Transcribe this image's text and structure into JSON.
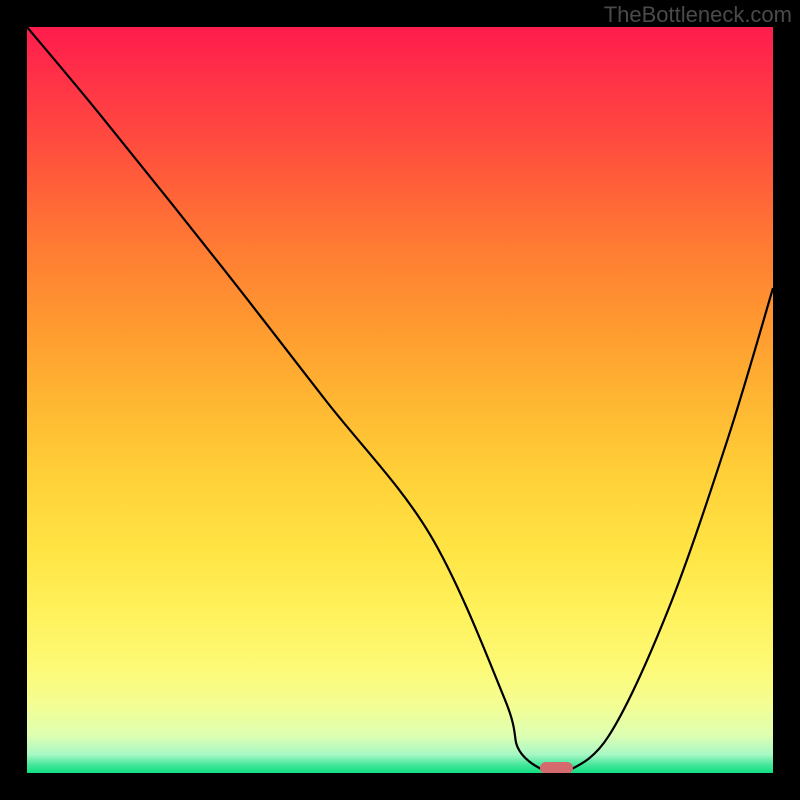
{
  "watermark": "TheBottleneck.com",
  "chart_data": {
    "type": "line",
    "title": "",
    "xlabel": "",
    "ylabel": "",
    "xlim": [
      0,
      100
    ],
    "ylim": [
      0,
      100
    ],
    "x": [
      0,
      10,
      26,
      40,
      54,
      64,
      66,
      70,
      72,
      78,
      86,
      94,
      100
    ],
    "values": [
      100,
      88,
      68,
      50,
      32,
      10,
      3,
      0,
      0,
      5,
      22,
      45,
      65
    ],
    "marker": {
      "x_center": 71,
      "width_pct": 4.5,
      "y": 0,
      "color": "#d46a6d"
    },
    "gradient_stops": [
      {
        "pct": 0,
        "color": "#ff1c4d"
      },
      {
        "pct": 50,
        "color": "#ffb632"
      },
      {
        "pct": 86,
        "color": "#fdfa77"
      },
      {
        "pct": 100,
        "color": "#10e080"
      }
    ]
  }
}
